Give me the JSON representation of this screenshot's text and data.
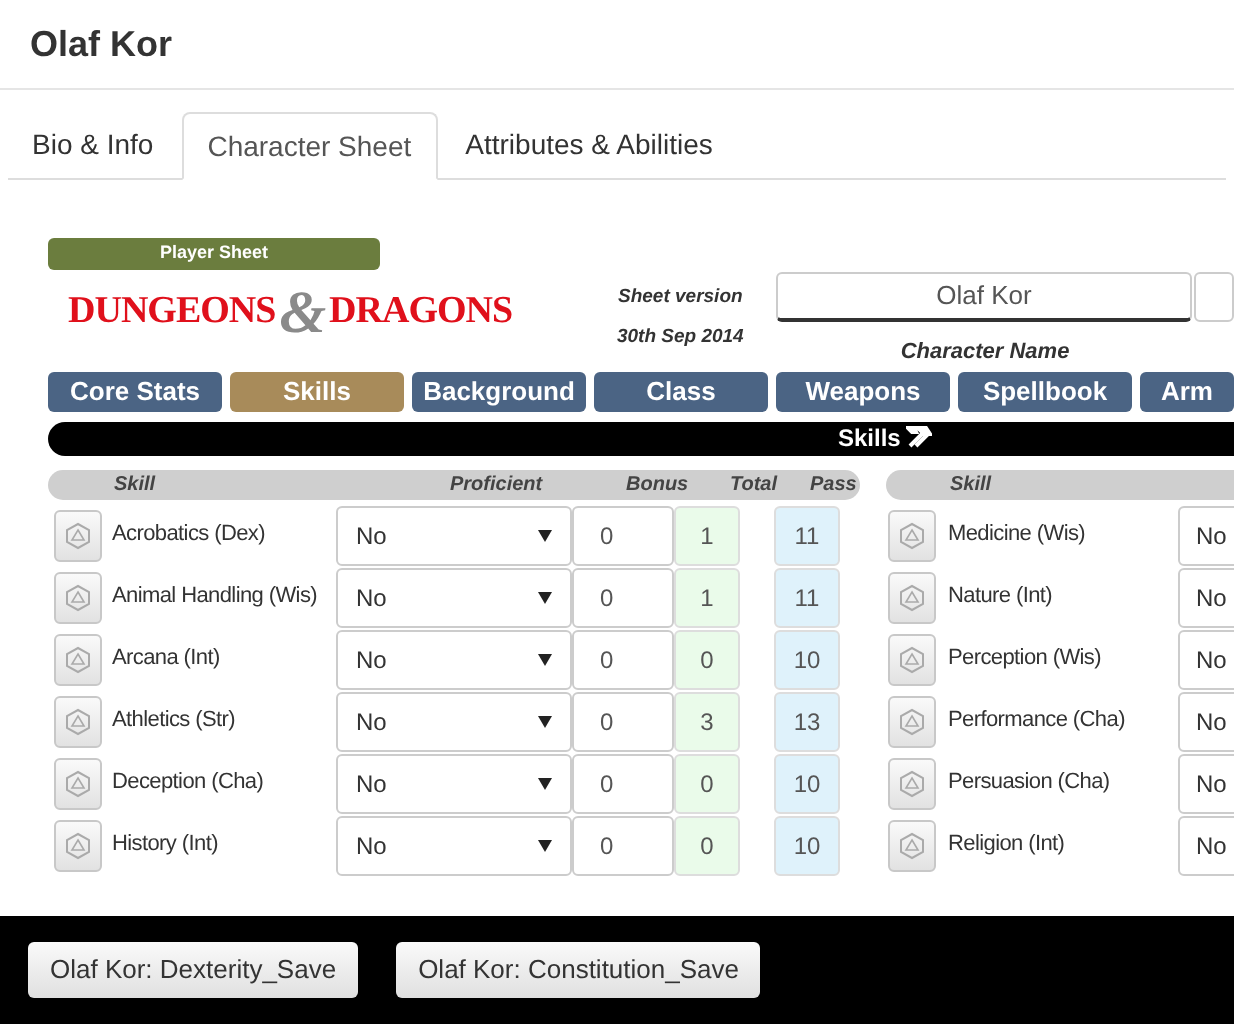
{
  "title": "Olaf Kor",
  "tabs": [
    {
      "label": "Bio & Info",
      "selected": false
    },
    {
      "label": "Character Sheet",
      "selected": true
    },
    {
      "label": "Attributes & Abilities",
      "selected": false
    }
  ],
  "sheet_label": "Player Sheet",
  "logo": {
    "left": "DUNGEONS",
    "amp": "&",
    "right": "DRAGONS"
  },
  "sheet_version": {
    "label": "Sheet version",
    "date": "30th Sep 2014"
  },
  "character_name": {
    "value": "Olaf Kor",
    "label": "Character Name"
  },
  "sections": [
    {
      "label": "Core Stats",
      "selected": false
    },
    {
      "label": "Skills",
      "selected": true
    },
    {
      "label": "Background",
      "selected": false
    },
    {
      "label": "Class",
      "selected": false
    },
    {
      "label": "Weapons",
      "selected": false
    },
    {
      "label": "Spellbook",
      "selected": false
    },
    {
      "label": "Arm",
      "selected": false
    }
  ],
  "section_title": "Skills",
  "skills_left": {
    "columns": [
      "Skill",
      "Proficient",
      "Bonus",
      "Total",
      "Pass"
    ],
    "rows": [
      {
        "name": "Acrobatics (Dex)",
        "proficient": "No",
        "bonus": "0",
        "total": "1",
        "pass": "11"
      },
      {
        "name": "Animal Handling (Wis)",
        "proficient": "No",
        "bonus": "0",
        "total": "1",
        "pass": "11"
      },
      {
        "name": "Arcana (Int)",
        "proficient": "No",
        "bonus": "0",
        "total": "0",
        "pass": "10"
      },
      {
        "name": "Athletics (Str)",
        "proficient": "No",
        "bonus": "0",
        "total": "3",
        "pass": "13"
      },
      {
        "name": "Deception (Cha)",
        "proficient": "No",
        "bonus": "0",
        "total": "0",
        "pass": "10"
      },
      {
        "name": "History (Int)",
        "proficient": "No",
        "bonus": "0",
        "total": "0",
        "pass": "10"
      }
    ]
  },
  "skills_right": {
    "columns": [
      "Skill"
    ],
    "rows": [
      {
        "name": "Medicine (Wis)",
        "proficient": "No"
      },
      {
        "name": "Nature (Int)",
        "proficient": "No"
      },
      {
        "name": "Perception (Wis)",
        "proficient": "No"
      },
      {
        "name": "Performance (Cha)",
        "proficient": "No"
      },
      {
        "name": "Persuasion (Cha)",
        "proficient": "No"
      },
      {
        "name": "Religion (Int)",
        "proficient": "No"
      }
    ]
  },
  "macro_buttons": [
    "Olaf Kor: Dexterity_Save",
    "Olaf Kor: Constitution_Save"
  ]
}
